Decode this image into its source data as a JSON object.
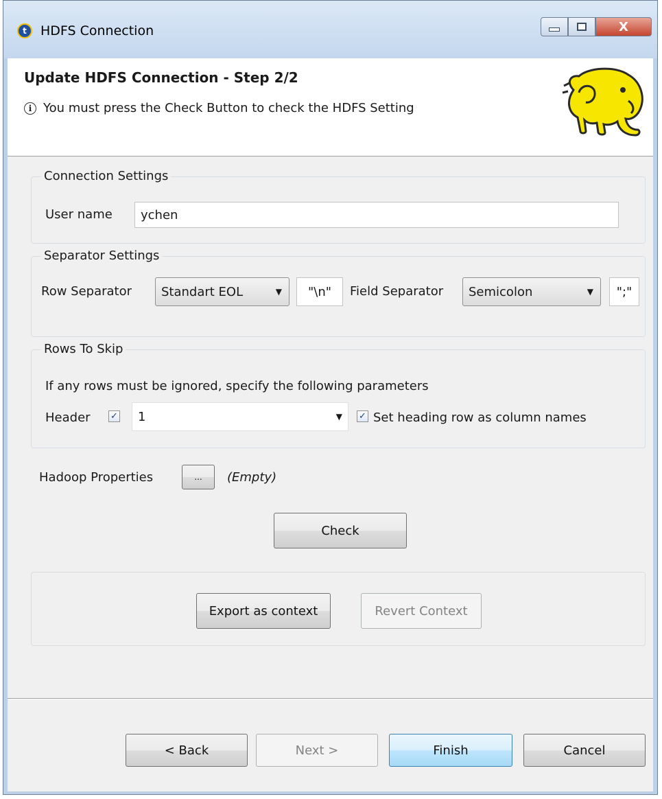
{
  "window": {
    "title": "HDFS Connection",
    "controls": {
      "minimize": "minimize-icon",
      "maximize": "maximize-icon",
      "close_label": "X"
    }
  },
  "banner": {
    "step_title": "Update HDFS Connection - Step 2/2",
    "info_icon_text": "i",
    "message": "You must press the Check Button to check the HDFS Setting",
    "logo": "hadoop-elephant-logo"
  },
  "connection_settings": {
    "legend": "Connection Settings",
    "username_label": "User name",
    "username_value": "ychen"
  },
  "separator_settings": {
    "legend": "Separator Settings",
    "row_separator_label": "Row Separator",
    "row_separator_selected": "Standart EOL",
    "row_separator_value": "\"\\n\"",
    "field_separator_label": "Field Separator",
    "field_separator_selected": "Semicolon",
    "field_separator_value": "\";\""
  },
  "rows_to_skip": {
    "legend": "Rows To Skip",
    "description": "If any rows must be ignored, specify the following parameters",
    "header_label": "Header",
    "header_checked": true,
    "header_value": "1",
    "heading_row_label": "Set heading row as column names",
    "heading_row_checked": true
  },
  "hadoop_properties": {
    "label": "Hadoop Properties",
    "button_label": "...",
    "value": "(Empty)"
  },
  "check_button": "Check",
  "context": {
    "export_label": "Export as context",
    "revert_label": "Revert Context"
  },
  "footer": {
    "back_label": "< Back",
    "next_label": "Next >",
    "finish_label": "Finish",
    "cancel_label": "Cancel"
  },
  "colors": {
    "frame": "#bcd0e8",
    "client_bg": "#f0f0f0",
    "logo_yellow": "#f7e600"
  }
}
